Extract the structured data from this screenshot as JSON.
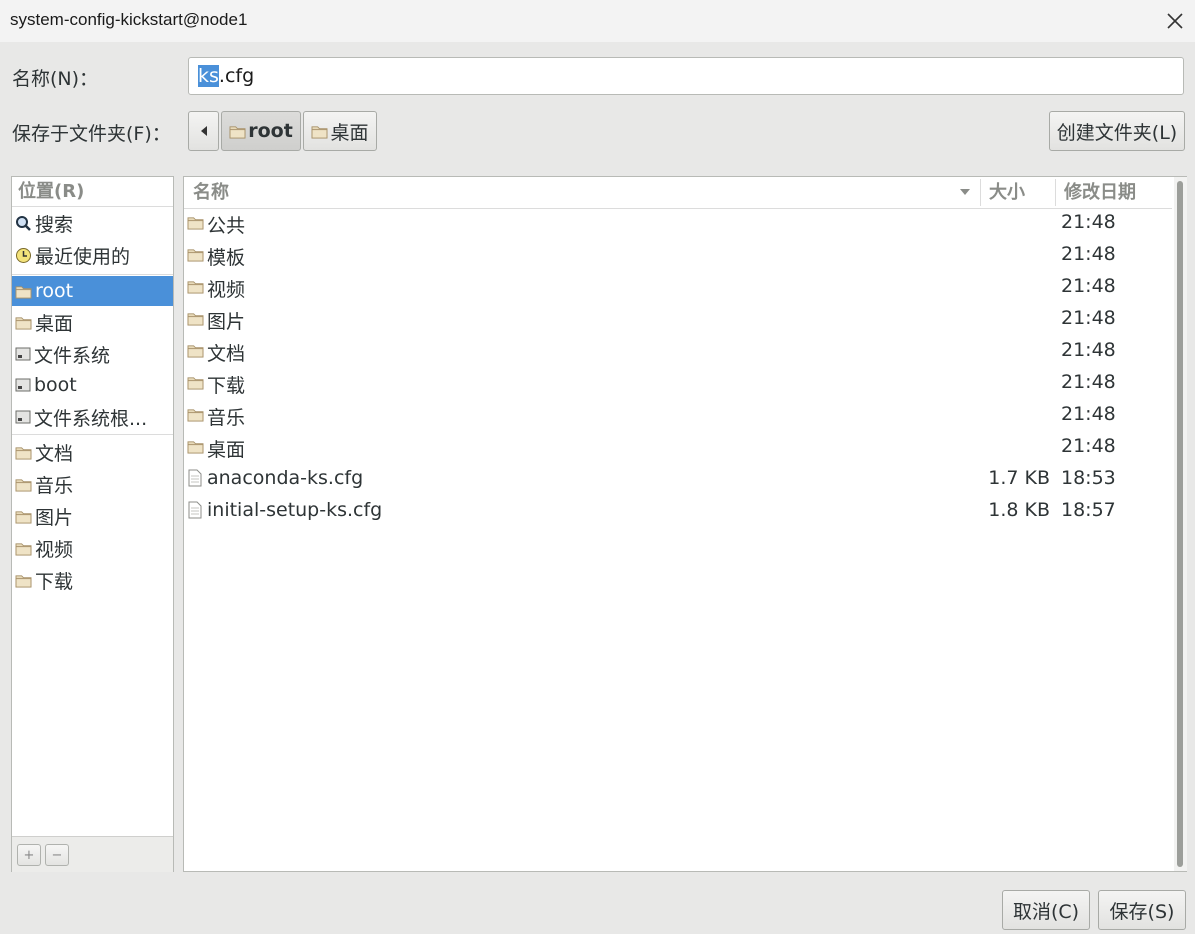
{
  "window": {
    "title": "system-config-kickstart@node1"
  },
  "name_field": {
    "label": "名称(N)：",
    "value_selected": "ks",
    "value_rest": ".cfg"
  },
  "folder_field": {
    "label": "保存于文件夹(F)：",
    "breadcrumbs": [
      "root",
      "桌面"
    ],
    "create_folder_label": "创建文件夹(L)"
  },
  "places": {
    "header": "位置(R)",
    "items": [
      {
        "label": "搜索",
        "icon": "search-icon"
      },
      {
        "label": "最近使用的",
        "icon": "recent-icon"
      },
      {
        "label": "root",
        "icon": "home-folder-icon",
        "selected": true
      },
      {
        "label": "桌面",
        "icon": "desktop-folder-icon"
      },
      {
        "label": "文件系统",
        "icon": "drive-icon"
      },
      {
        "label": "boot",
        "icon": "drive-icon"
      },
      {
        "label": "文件系统根...",
        "icon": "drive-icon"
      },
      {
        "label": "文档",
        "icon": "documents-folder-icon"
      },
      {
        "label": "音乐",
        "icon": "music-folder-icon"
      },
      {
        "label": "图片",
        "icon": "pictures-folder-icon"
      },
      {
        "label": "视频",
        "icon": "videos-folder-icon"
      },
      {
        "label": "下载",
        "icon": "downloads-folder-icon"
      }
    ],
    "add_label": "+",
    "remove_label": "−"
  },
  "files": {
    "columns": {
      "name": "名称",
      "size": "大小",
      "modified": "修改日期"
    },
    "rows": [
      {
        "name": "公共",
        "size": "",
        "modified": "21:48",
        "type": "folder"
      },
      {
        "name": "模板",
        "size": "",
        "modified": "21:48",
        "type": "folder"
      },
      {
        "name": "视频",
        "size": "",
        "modified": "21:48",
        "type": "folder"
      },
      {
        "name": "图片",
        "size": "",
        "modified": "21:48",
        "type": "folder"
      },
      {
        "name": "文档",
        "size": "",
        "modified": "21:48",
        "type": "folder"
      },
      {
        "name": "下载",
        "size": "",
        "modified": "21:48",
        "type": "folder"
      },
      {
        "name": "音乐",
        "size": "",
        "modified": "21:48",
        "type": "folder"
      },
      {
        "name": "桌面",
        "size": "",
        "modified": "21:48",
        "type": "folder"
      },
      {
        "name": "anaconda-ks.cfg",
        "size": "1.7 KB",
        "modified": "18:53",
        "type": "file"
      },
      {
        "name": "initial-setup-ks.cfg",
        "size": "1.8 KB",
        "modified": "18:57",
        "type": "file"
      }
    ]
  },
  "buttons": {
    "cancel": "取消(C)",
    "save": "保存(S)"
  },
  "colors": {
    "selection": "#4a90d9",
    "folder": "#c9b48c",
    "window_bg": "#e8e8e7"
  }
}
